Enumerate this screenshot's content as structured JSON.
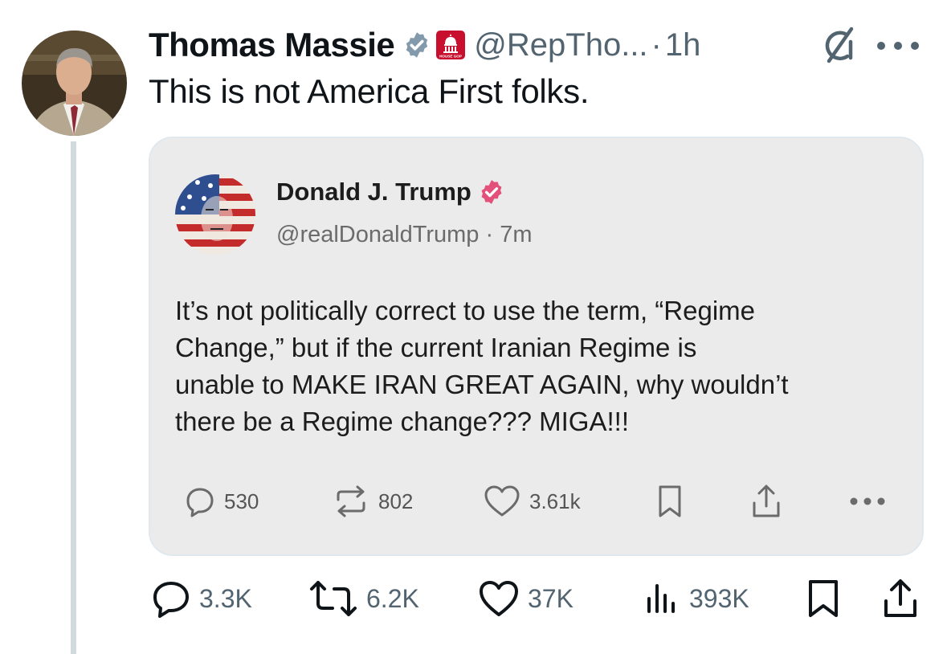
{
  "post": {
    "author_name": "Thomas Massie",
    "handle": "@RepTho...",
    "separator": "·",
    "time": "1h",
    "text": "This is not America First folks.",
    "affiliation_badge_text": "HOUSE GOP",
    "icons": {
      "verified": "verified-badge-icon",
      "affiliation": "affiliation-badge-icon",
      "grok": "grok-icon",
      "more": "more-icon",
      "reply": "reply-icon",
      "repost": "repost-icon",
      "like": "like-icon",
      "views": "views-icon",
      "bookmark": "bookmark-icon",
      "share": "share-icon"
    },
    "stats": {
      "replies": "3.3K",
      "reposts": "6.2K",
      "likes": "37K",
      "views": "393K"
    }
  },
  "quote": {
    "author_name": "Donald J. Trump",
    "handle": "@realDonaldTrump",
    "separator": "·",
    "time": "7m",
    "text_lines": [
      "It’s not politically correct to use the term, “Regime",
      "Change,” but if the current Iranian Regime is",
      "unable to MAKE IRAN GREAT AGAIN, why wouldn’t",
      "there be a Regime change??? MIGA!!!"
    ],
    "stats": {
      "replies": "530",
      "reposts": "802",
      "likes": "3.61k"
    }
  },
  "colors": {
    "text_primary": "#0f1419",
    "text_secondary": "#536471",
    "verified_blue": "#829aab",
    "verified_pink": "#e3507a",
    "badge_red": "#c8102e",
    "quote_background": "#ebebeb",
    "thread_line": "#cfd9de"
  }
}
